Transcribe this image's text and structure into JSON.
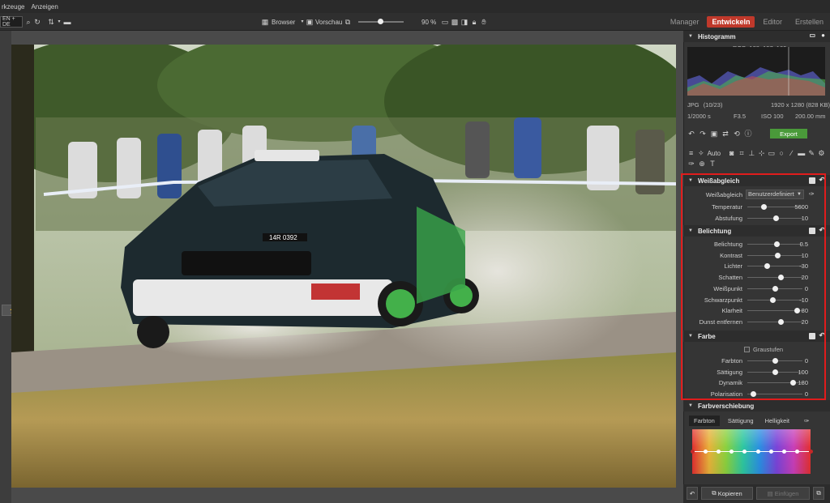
{
  "menu": {
    "items": [
      "rkzeuge",
      "Anzeigen"
    ]
  },
  "toolbar": {
    "search_text": "EN + DE",
    "browser_label": "Browser",
    "preview_label": "Vorschau",
    "zoom": "90 %"
  },
  "modes": {
    "manager": "Manager",
    "develop": "Entwickeln",
    "editor": "Editor",
    "create": "Erstellen"
  },
  "histogram": {
    "title": "Histogramm",
    "rgb": "RGB: 188, 197, 160",
    "format": "JPG",
    "index": "(10/23)",
    "dimensions": "1920 x 1280 (828 KB)",
    "shutter": "1/2000 s",
    "aperture": "F3.5",
    "iso": "ISO 100",
    "focal": "200.00 mm"
  },
  "tools": {
    "auto": "Auto",
    "export": "Export"
  },
  "white_balance": {
    "title": "Weißabgleich",
    "preset_label": "Weißabgleich",
    "preset_value": "Benutzerdefiniert",
    "rows": [
      {
        "label": "Temperatur",
        "value": "5600",
        "pos": 0.3
      },
      {
        "label": "Abstufung",
        "value": "10",
        "pos": 0.52
      }
    ]
  },
  "exposure": {
    "title": "Belichtung",
    "rows": [
      {
        "label": "Belichtung",
        "value": "0.5",
        "pos": 0.53
      },
      {
        "label": "Kontrast",
        "value": "10",
        "pos": 0.55
      },
      {
        "label": "Lichter",
        "value": "-30",
        "pos": 0.35
      },
      {
        "label": "Schatten",
        "value": "20",
        "pos": 0.6
      },
      {
        "label": "Weißpunkt",
        "value": "0",
        "pos": 0.5
      },
      {
        "label": "Schwarzpunkt",
        "value": "-10",
        "pos": 0.45
      },
      {
        "label": "Klarheit",
        "value": "80",
        "pos": 0.9
      },
      {
        "label": "Dunst entfernen",
        "value": "20",
        "pos": 0.6
      }
    ]
  },
  "color": {
    "title": "Farbe",
    "grayscale": "Graustufen",
    "rows": [
      {
        "label": "Farbton",
        "value": "0",
        "pos": 0.5
      },
      {
        "label": "Sättigung",
        "value": "100",
        "pos": 0.5
      },
      {
        "label": "Dynamik",
        "value": "180",
        "pos": 0.82
      },
      {
        "label": "Polarisation",
        "value": "0",
        "pos": 0.1
      }
    ]
  },
  "color_shift": {
    "title": "Farbverschiebung",
    "tabs": [
      "Farbton",
      "Sättigung",
      "Helligkeit"
    ]
  },
  "bottom": {
    "copy": "Kopieren",
    "paste": "Einfügen"
  }
}
